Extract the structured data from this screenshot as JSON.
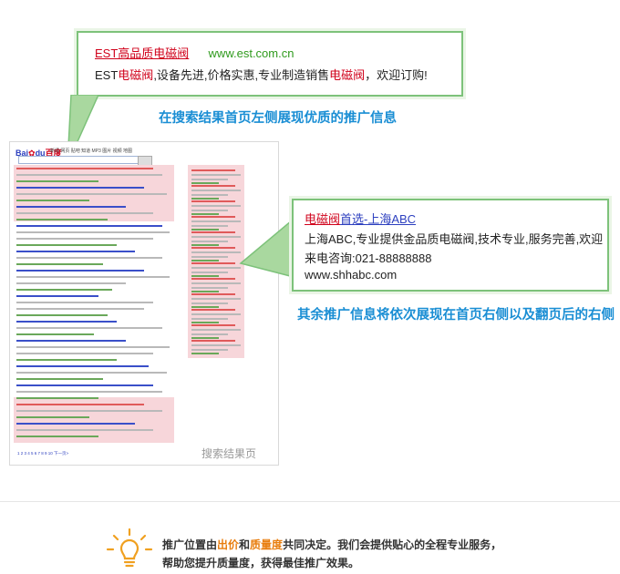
{
  "top_callout": {
    "brand": "EST高品质电磁阀",
    "url": "www.est.com.cn",
    "desc_prefix": "EST",
    "desc_kw1": "电磁阀",
    "desc_mid": ",设备先进,价格实惠,专业制造销售",
    "desc_kw2": "电磁阀",
    "desc_suffix": "，欢迎订购!"
  },
  "caption_left": "在搜索结果首页左侧展现优质的推广信息",
  "mock_page": {
    "logo_a": "Bai",
    "logo_b": "du",
    "logo_c": "百度",
    "tabs": "新闻  网页  贴吧  知道  MP3  图片  视频  地图",
    "label": "搜索结果页",
    "pager": "1 2 3 4 5 6 7 8 9 10 下一页>"
  },
  "right_callout": {
    "title_kw": "电磁阀",
    "title_rest": "首选-上海ABC",
    "line2": "上海ABC,专业提供金品质电磁阀,技术专业,服务完善,欢迎",
    "line3": "来电咨询:021-88888888",
    "url": "www.shhabc.com"
  },
  "caption_right": "其余推广信息将依次展现在首页右侧以及翻页后的右侧",
  "footer": {
    "l1_a": "推广位置由",
    "l1_b": "出价",
    "l1_c": "和",
    "l1_d": "质量度",
    "l1_e": "共同决定。我们会提供贴心的全程专业服务，",
    "l2": "帮助您提升质量度，获得最佳推广效果。"
  },
  "colors": {
    "accent_green": "#7dc27a",
    "keyword_red": "#d0021b",
    "caption_blue": "#1a8ed4",
    "bulb_orange": "#f0a020"
  }
}
